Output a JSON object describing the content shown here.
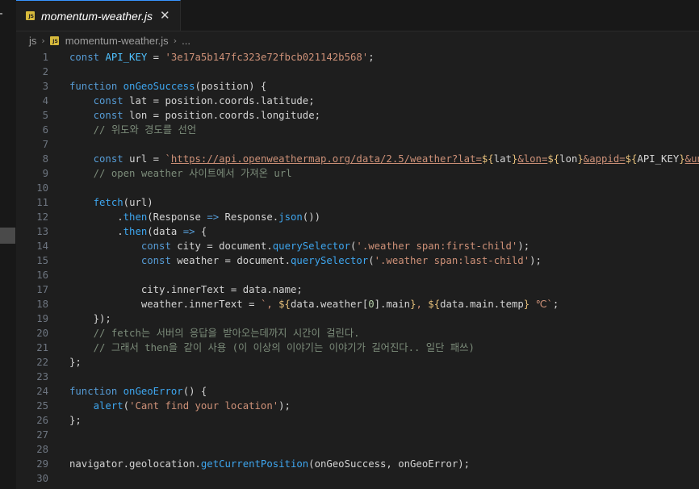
{
  "tab": {
    "title": "momentum-weather.js",
    "icon_text": "JS",
    "close_glyph": "✕"
  },
  "breadcrumb": {
    "folder": "js",
    "file": "momentum-weather.js",
    "more": "..."
  },
  "editor": {
    "lines": [
      {
        "n": "1",
        "tokens": [
          [
            "k",
            "const"
          ],
          [
            "p",
            " "
          ],
          [
            "c",
            "API_KEY"
          ],
          [
            "p",
            " = "
          ],
          [
            "s",
            "'3e17a5b147fc323e72fbcb021142b568'"
          ],
          [
            "p",
            ";"
          ]
        ]
      },
      {
        "n": "2",
        "tokens": []
      },
      {
        "n": "3",
        "tokens": [
          [
            "k",
            "function"
          ],
          [
            "p",
            " "
          ],
          [
            "f",
            "onGeoSuccess"
          ],
          [
            "p",
            "("
          ],
          [
            "v",
            "position"
          ],
          [
            "p",
            ") {"
          ]
        ]
      },
      {
        "n": "4",
        "tokens": [
          [
            "p",
            "    "
          ],
          [
            "k",
            "const"
          ],
          [
            "p",
            " "
          ],
          [
            "v",
            "lat"
          ],
          [
            "p",
            " = "
          ],
          [
            "v",
            "position"
          ],
          [
            "p",
            "."
          ],
          [
            "v",
            "coords"
          ],
          [
            "p",
            "."
          ],
          [
            "v",
            "latitude"
          ],
          [
            "p",
            ";"
          ]
        ]
      },
      {
        "n": "5",
        "tokens": [
          [
            "p",
            "    "
          ],
          [
            "k",
            "const"
          ],
          [
            "p",
            " "
          ],
          [
            "v",
            "lon"
          ],
          [
            "p",
            " = "
          ],
          [
            "v",
            "position"
          ],
          [
            "p",
            "."
          ],
          [
            "v",
            "coords"
          ],
          [
            "p",
            "."
          ],
          [
            "v",
            "longitude"
          ],
          [
            "p",
            ";"
          ]
        ]
      },
      {
        "n": "6",
        "tokens": [
          [
            "p",
            "    "
          ],
          [
            "cm",
            "// 위도와 경도를 선언"
          ]
        ]
      },
      {
        "n": "7",
        "tokens": []
      },
      {
        "n": "8",
        "tokens": [
          [
            "p",
            "    "
          ],
          [
            "k",
            "const"
          ],
          [
            "p",
            " "
          ],
          [
            "v",
            "url"
          ],
          [
            "p",
            " = "
          ],
          [
            "s",
            "`"
          ],
          [
            "url",
            "https://api.openweathermap.org/data/2.5/weather?lat="
          ],
          [
            "tp",
            "${"
          ],
          [
            "v",
            "lat"
          ],
          [
            "tp",
            "}"
          ],
          [
            "url",
            "&lon="
          ],
          [
            "tp",
            "${"
          ],
          [
            "v",
            "lon"
          ],
          [
            "tp",
            "}"
          ],
          [
            "url",
            "&appid="
          ],
          [
            "tp",
            "${"
          ],
          [
            "v",
            "API_KEY"
          ],
          [
            "tp",
            "}"
          ],
          [
            "url",
            "&unit"
          ]
        ]
      },
      {
        "n": "9",
        "tokens": [
          [
            "p",
            "    "
          ],
          [
            "cm",
            "// open weather 사이트에서 가져온 url"
          ]
        ]
      },
      {
        "n": "10",
        "tokens": []
      },
      {
        "n": "11",
        "tokens": [
          [
            "p",
            "    "
          ],
          [
            "f",
            "fetch"
          ],
          [
            "p",
            "("
          ],
          [
            "v",
            "url"
          ],
          [
            "p",
            ")"
          ]
        ]
      },
      {
        "n": "12",
        "tokens": [
          [
            "p",
            "        ."
          ],
          [
            "f",
            "then"
          ],
          [
            "p",
            "("
          ],
          [
            "v",
            "Response"
          ],
          [
            "p",
            " "
          ],
          [
            "k",
            "=>"
          ],
          [
            "p",
            " "
          ],
          [
            "v",
            "Response"
          ],
          [
            "p",
            "."
          ],
          [
            "f",
            "json"
          ],
          [
            "p",
            "())"
          ]
        ]
      },
      {
        "n": "13",
        "tokens": [
          [
            "p",
            "        ."
          ],
          [
            "f",
            "then"
          ],
          [
            "p",
            "("
          ],
          [
            "v",
            "data"
          ],
          [
            "p",
            " "
          ],
          [
            "k",
            "=>"
          ],
          [
            "p",
            " {"
          ]
        ]
      },
      {
        "n": "14",
        "tokens": [
          [
            "p",
            "            "
          ],
          [
            "k",
            "const"
          ],
          [
            "p",
            " "
          ],
          [
            "v",
            "city"
          ],
          [
            "p",
            " = "
          ],
          [
            "v",
            "document"
          ],
          [
            "p",
            "."
          ],
          [
            "f",
            "querySelector"
          ],
          [
            "p",
            "("
          ],
          [
            "s",
            "'.weather span:first-child'"
          ],
          [
            "p",
            ");"
          ]
        ]
      },
      {
        "n": "15",
        "tokens": [
          [
            "p",
            "            "
          ],
          [
            "k",
            "const"
          ],
          [
            "p",
            " "
          ],
          [
            "v",
            "weather"
          ],
          [
            "p",
            " = "
          ],
          [
            "v",
            "document"
          ],
          [
            "p",
            "."
          ],
          [
            "f",
            "querySelector"
          ],
          [
            "p",
            "("
          ],
          [
            "s",
            "'.weather span:last-child'"
          ],
          [
            "p",
            ");"
          ]
        ]
      },
      {
        "n": "16",
        "tokens": []
      },
      {
        "n": "17",
        "tokens": [
          [
            "p",
            "            "
          ],
          [
            "v",
            "city"
          ],
          [
            "p",
            "."
          ],
          [
            "v",
            "innerText"
          ],
          [
            "p",
            " = "
          ],
          [
            "v",
            "data"
          ],
          [
            "p",
            "."
          ],
          [
            "v",
            "name"
          ],
          [
            "p",
            ";"
          ]
        ]
      },
      {
        "n": "18",
        "tokens": [
          [
            "p",
            "            "
          ],
          [
            "v",
            "weather"
          ],
          [
            "p",
            "."
          ],
          [
            "v",
            "innerText"
          ],
          [
            "p",
            " = "
          ],
          [
            "s",
            "`, "
          ],
          [
            "tp",
            "${"
          ],
          [
            "v",
            "data"
          ],
          [
            "p",
            "."
          ],
          [
            "v",
            "weather"
          ],
          [
            "p",
            "["
          ],
          [
            "num",
            "0"
          ],
          [
            "p",
            "]."
          ],
          [
            "v",
            "main"
          ],
          [
            "tp",
            "}"
          ],
          [
            "s",
            ", "
          ],
          [
            "tp",
            "${"
          ],
          [
            "v",
            "data"
          ],
          [
            "p",
            "."
          ],
          [
            "v",
            "main"
          ],
          [
            "p",
            "."
          ],
          [
            "v",
            "temp"
          ],
          [
            "tp",
            "}"
          ],
          [
            "s",
            " ℃`"
          ],
          [
            "p",
            ";"
          ]
        ]
      },
      {
        "n": "19",
        "tokens": [
          [
            "p",
            "    });"
          ]
        ]
      },
      {
        "n": "20",
        "tokens": [
          [
            "p",
            "    "
          ],
          [
            "cm",
            "// fetch는 서버의 응답을 받아오는데까지 시간이 걸린다."
          ]
        ]
      },
      {
        "n": "21",
        "tokens": [
          [
            "p",
            "    "
          ],
          [
            "cm",
            "// 그래서 then을 같이 사용 (이 이상의 이야기는 이야기가 길어진다.. 일단 패쓰)"
          ]
        ]
      },
      {
        "n": "22",
        "tokens": [
          [
            "p",
            "};"
          ]
        ]
      },
      {
        "n": "23",
        "tokens": []
      },
      {
        "n": "24",
        "tokens": [
          [
            "k",
            "function"
          ],
          [
            "p",
            " "
          ],
          [
            "f",
            "onGeoError"
          ],
          [
            "p",
            "() {"
          ]
        ]
      },
      {
        "n": "25",
        "tokens": [
          [
            "p",
            "    "
          ],
          [
            "f",
            "alert"
          ],
          [
            "p",
            "("
          ],
          [
            "s",
            "'Cant find your location'"
          ],
          [
            "p",
            ");"
          ]
        ]
      },
      {
        "n": "26",
        "tokens": [
          [
            "p",
            "};"
          ]
        ]
      },
      {
        "n": "27",
        "tokens": []
      },
      {
        "n": "28",
        "tokens": []
      },
      {
        "n": "29",
        "tokens": [
          [
            "v",
            "navigator"
          ],
          [
            "p",
            "."
          ],
          [
            "v",
            "geolocation"
          ],
          [
            "p",
            "."
          ],
          [
            "f",
            "getCurrentPosition"
          ],
          [
            "p",
            "("
          ],
          [
            "v",
            "onGeoSuccess"
          ],
          [
            "p",
            ", "
          ],
          [
            "v",
            "onGeoError"
          ],
          [
            "p",
            ");"
          ]
        ]
      },
      {
        "n": "30",
        "tokens": []
      }
    ]
  }
}
